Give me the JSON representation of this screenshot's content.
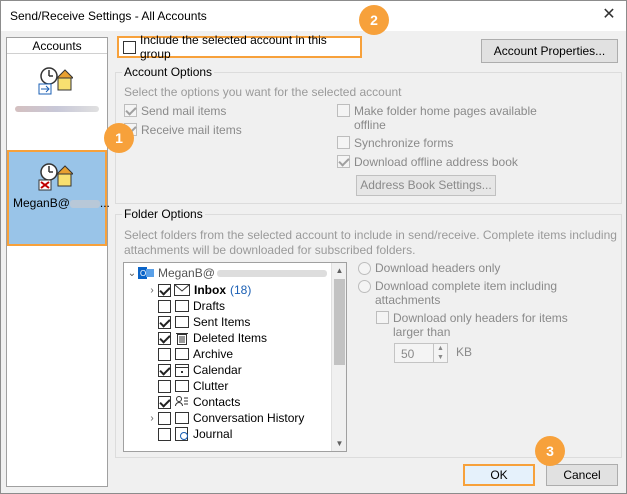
{
  "window": {
    "title": "Send/Receive Settings - All Accounts",
    "close_glyph": "✕"
  },
  "accounts": {
    "header": "Accounts",
    "items": [
      {
        "label": ""
      },
      {
        "label": "MeganB@",
        "suffix": "..."
      }
    ]
  },
  "group_checkbox": {
    "label": "Include the selected account in this group",
    "checked": false
  },
  "account_properties_button": "Account Properties...",
  "account_options": {
    "title": "Account Options",
    "hint": "Select the options you want for the selected account",
    "send_mail": "Send mail items",
    "receive_mail": "Receive mail items",
    "folder_home_line1": "Make folder home pages available",
    "folder_home_line2": "offline",
    "sync_forms": "Synchronize forms",
    "download_oab": "Download offline address book",
    "address_book_button": "Address Book Settings..."
  },
  "folder_options": {
    "title": "Folder Options",
    "hint_line1": "Select folders from the selected account to include in send/receive. Complete items including",
    "hint_line2": "attachments will be downloaded for subscribed folders.",
    "tree": {
      "root_label": "MeganB@",
      "folders": [
        {
          "name": "Inbox",
          "count": "(18)",
          "checked": true,
          "expander": true
        },
        {
          "name": "Drafts",
          "checked": false,
          "expander": false
        },
        {
          "name": "Sent Items",
          "checked": true,
          "expander": false
        },
        {
          "name": "Deleted Items",
          "checked": true,
          "expander": false
        },
        {
          "name": "Archive",
          "checked": false,
          "expander": false
        },
        {
          "name": "Calendar",
          "checked": true,
          "expander": false
        },
        {
          "name": "Clutter",
          "checked": false,
          "expander": false
        },
        {
          "name": "Contacts",
          "checked": true,
          "expander": false
        },
        {
          "name": "Conversation History",
          "checked": false,
          "expander": true
        },
        {
          "name": "Journal",
          "checked": false,
          "expander": false
        }
      ]
    },
    "download_headers_only": "Download headers only",
    "download_complete_line1": "Download complete item including",
    "download_complete_line2": "attachments",
    "download_only_headers_line1": "Download only headers for items",
    "download_only_headers_line2": "larger than",
    "size_value": "50",
    "size_unit": "KB"
  },
  "footer": {
    "ok": "OK",
    "cancel": "Cancel"
  },
  "markers": [
    "1",
    "2",
    "3"
  ],
  "colors": {
    "accent": "#f7a13b",
    "selected_account": "#99c4e8",
    "inbox_count": "#1a5fb4"
  }
}
